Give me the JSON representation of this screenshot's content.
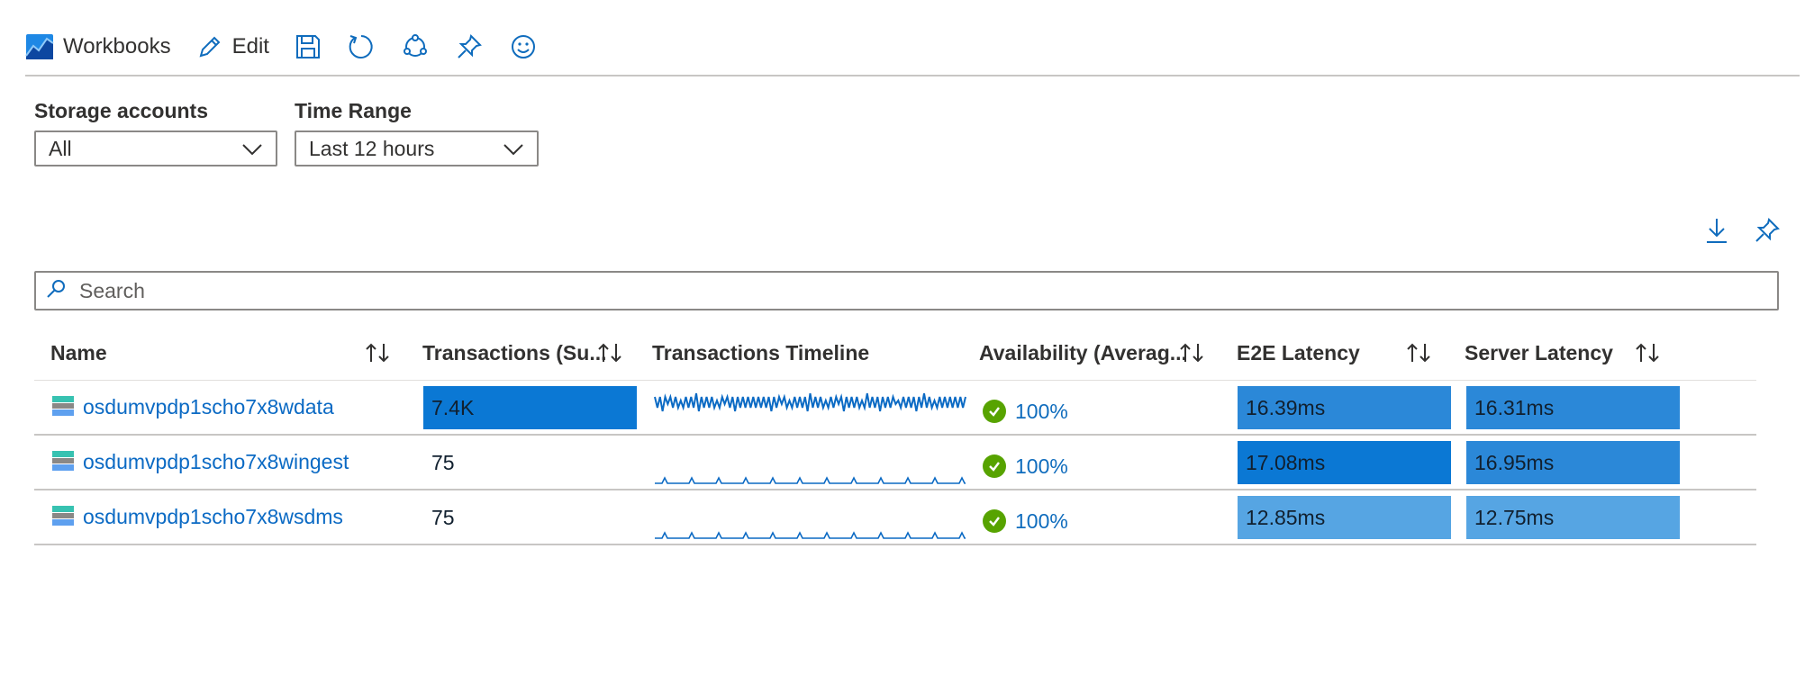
{
  "toolbar": {
    "workbooks_label": "Workbooks",
    "edit_label": "Edit"
  },
  "params": {
    "storage": {
      "label": "Storage accounts",
      "value": "All"
    },
    "time": {
      "label": "Time Range",
      "value": "Last 12 hours"
    }
  },
  "search": {
    "placeholder": "Search"
  },
  "table": {
    "headers": {
      "name": "Name",
      "transactions": "Transactions (Su...",
      "timeline": "Transactions Timeline",
      "availability": "Availability (Averag...",
      "e2e": "E2E Latency",
      "server": "Server Latency"
    },
    "rows": [
      {
        "name": "osdumvpdp1scho7x8wdata",
        "transactions": "7.4K",
        "transactions_fraction": 1.0,
        "availability": "100%",
        "e2e": "16.39ms",
        "server": "16.31ms"
      },
      {
        "name": "osdumvpdp1scho7x8wingest",
        "transactions": "75",
        "transactions_fraction": 0.0,
        "availability": "100%",
        "e2e": "17.08ms",
        "server": "16.95ms"
      },
      {
        "name": "osdumvpdp1scho7x8wsdms",
        "transactions": "75",
        "transactions_fraction": 0.0,
        "availability": "100%",
        "e2e": "12.85ms",
        "server": "12.75ms"
      }
    ]
  },
  "icons": {
    "toolbar": [
      "workbooks-icon",
      "edit-icon",
      "save-icon",
      "refresh-icon",
      "share-icon",
      "pin-icon",
      "feedback-icon"
    ],
    "grid_actions": [
      "download-icon",
      "pin-icon"
    ],
    "row": [
      "storage-account-icon",
      "success-check-icon"
    ]
  },
  "colors": {
    "accent": "#0f6cbd",
    "transactions_bar": "#0b78d4",
    "latency_high": "#0b78d4",
    "latency_mid": "#2b88d8",
    "latency_low": "#56a5e3",
    "success": "#57a300"
  }
}
